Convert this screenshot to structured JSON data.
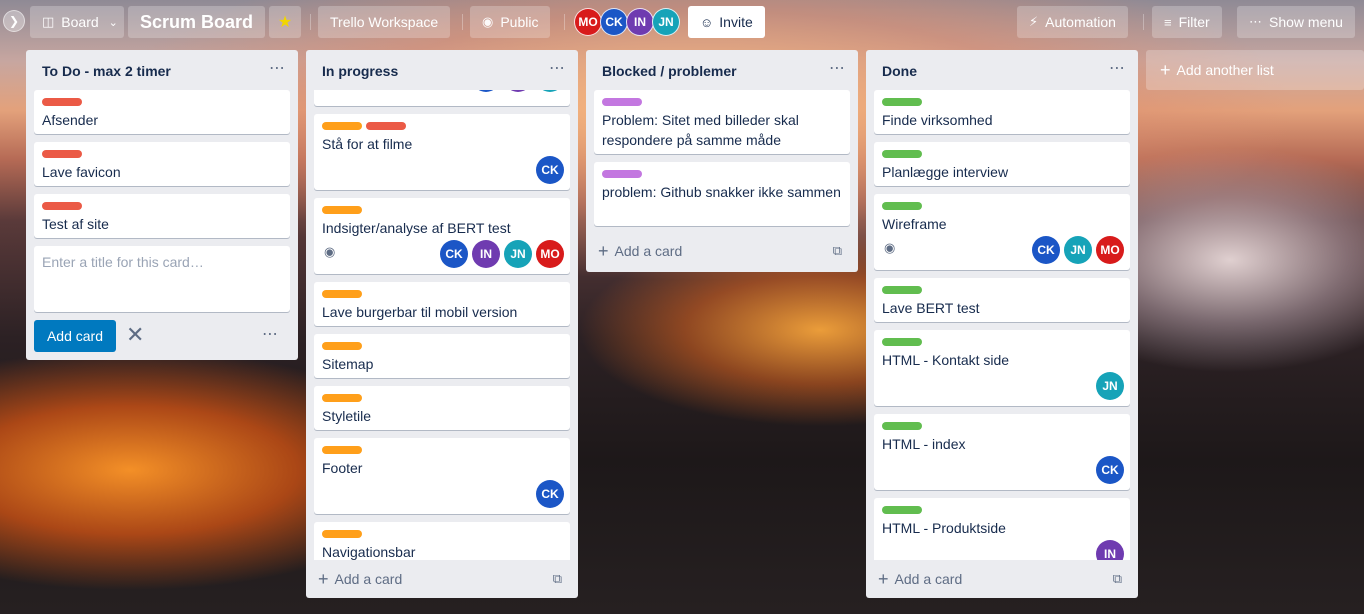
{
  "topbar": {
    "expander_icon": "chevron-right-icon",
    "board_menu": "Board",
    "board_title": "Scrum Board",
    "workspace": "Trello Workspace",
    "visibility": "Public",
    "members": [
      "MO",
      "CK",
      "IN",
      "JN"
    ],
    "invite": "Invite",
    "automation": "Automation",
    "filter": "Filter",
    "show_menu": "Show menu"
  },
  "lists": [
    {
      "title": "To Do - max 2 timer",
      "cards": [
        {
          "labels": [
            "red"
          ],
          "title": "Afsender"
        },
        {
          "labels": [
            "red"
          ],
          "title": "Lave favicon"
        },
        {
          "labels": [
            "red"
          ],
          "title": "Test af site"
        }
      ],
      "composer": {
        "placeholder": "Enter a title for this card…",
        "add_button": "Add card"
      }
    },
    {
      "title": "In progress",
      "cards": [
        {
          "labels": [],
          "title": "",
          "members": [
            "CK",
            "IN",
            "JN"
          ]
        },
        {
          "labels": [
            "orange",
            "red"
          ],
          "title": "Stå for at filme",
          "members": [
            "CK"
          ]
        },
        {
          "labels": [
            "orange"
          ],
          "title": "Indsigter/analyse af BERT test",
          "members": [
            "CK",
            "IN",
            "JN",
            "MO"
          ],
          "watching": true
        },
        {
          "labels": [
            "orange"
          ],
          "title": "Lave burgerbar til mobil version"
        },
        {
          "labels": [
            "orange"
          ],
          "title": "Sitemap"
        },
        {
          "labels": [
            "orange"
          ],
          "title": "Styletile"
        },
        {
          "labels": [
            "orange"
          ],
          "title": "Footer",
          "members": [
            "CK"
          ]
        },
        {
          "labels": [
            "orange"
          ],
          "title": "Navigationsbar"
        }
      ],
      "add_card": "Add a card"
    },
    {
      "title": "Blocked / problemer",
      "cards": [
        {
          "labels": [
            "purple"
          ],
          "title": "Problem: Sitet med billeder skal respondere på samme måde"
        },
        {
          "labels": [
            "purple"
          ],
          "title": "problem: Github snakker ikke sammen"
        }
      ],
      "add_card": "Add a card"
    },
    {
      "title": "Done",
      "cards": [
        {
          "labels": [
            "green"
          ],
          "title": "Finde virksomhed"
        },
        {
          "labels": [
            "green"
          ],
          "title": "Planlægge interview"
        },
        {
          "labels": [
            "green"
          ],
          "title": "Wireframe",
          "members": [
            "CK",
            "JN",
            "MO"
          ],
          "watching": true
        },
        {
          "labels": [
            "green"
          ],
          "title": "Lave BERT test"
        },
        {
          "labels": [
            "green"
          ],
          "title": "HTML - Kontakt side",
          "members": [
            "JN"
          ]
        },
        {
          "labels": [
            "green"
          ],
          "title": "HTML - index",
          "members": [
            "CK"
          ]
        },
        {
          "labels": [
            "green"
          ],
          "title": "HTML - Produktside",
          "members": [
            "IN"
          ]
        }
      ],
      "add_card": "Add a card"
    }
  ],
  "add_list": "Add another list",
  "colors": {
    "red": "#eb5a46",
    "orange": "#ff9f1a",
    "green": "#61bd4f",
    "purple": "#c377e0",
    "primary": "#0079bf"
  }
}
